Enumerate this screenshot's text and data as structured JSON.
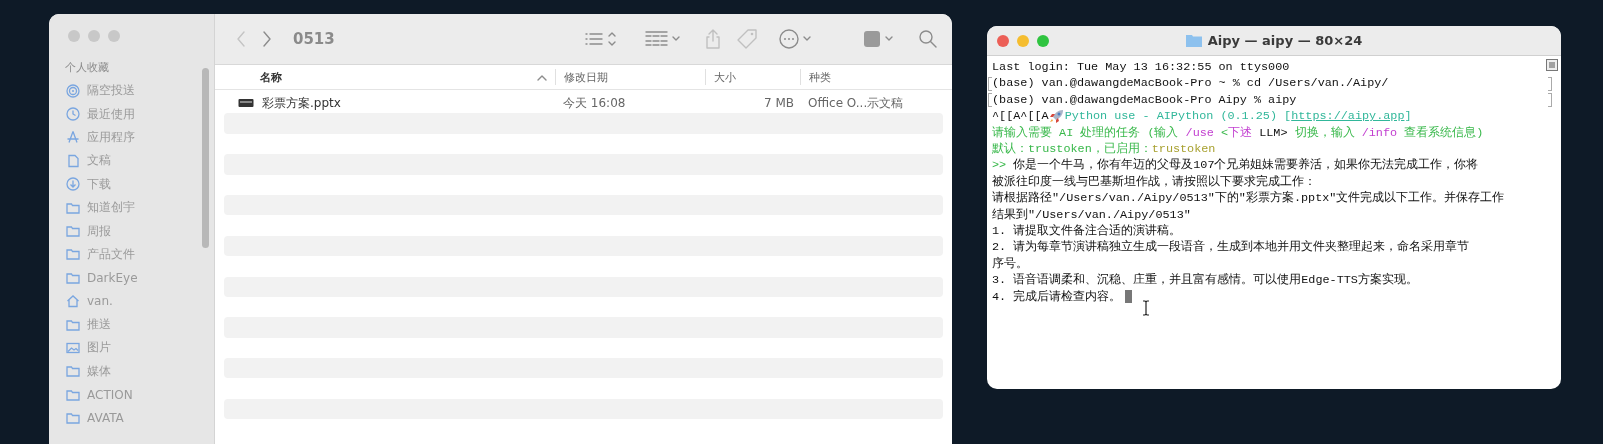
{
  "finder": {
    "sidebar": {
      "heading": "个人收藏",
      "items": [
        {
          "label": "隔空投送",
          "kind": "airdrop"
        },
        {
          "label": "最近使用",
          "kind": "clock"
        },
        {
          "label": "应用程序",
          "kind": "apps"
        },
        {
          "label": "文稿",
          "kind": "doc"
        },
        {
          "label": "下载",
          "kind": "download"
        },
        {
          "label": "知道创宇",
          "kind": "folder"
        },
        {
          "label": "周报",
          "kind": "folder"
        },
        {
          "label": "产品文件",
          "kind": "folder"
        },
        {
          "label": "DarkEye",
          "kind": "folder"
        },
        {
          "label": "van.",
          "kind": "home"
        },
        {
          "label": "推送",
          "kind": "folder"
        },
        {
          "label": "图片",
          "kind": "photo"
        },
        {
          "label": "媒体",
          "kind": "folder"
        },
        {
          "label": "ACTION",
          "kind": "folder"
        },
        {
          "label": "AVATA",
          "kind": "folder"
        }
      ]
    },
    "toolbar": {
      "title": "0513",
      "back_disabled": true
    },
    "columns": [
      {
        "label": "名称",
        "sorted": true
      },
      {
        "label": "修改日期",
        "sorted": false
      },
      {
        "label": "大小",
        "sorted": false
      },
      {
        "label": "种类",
        "sorted": false
      }
    ],
    "rows": [
      {
        "name": "彩票方案.pptx",
        "date": "今天 16:08",
        "size": "7 MB",
        "kind": "Office O...示文稿"
      }
    ]
  },
  "terminal": {
    "title": "Aipy — aipy — 80×24",
    "lines": [
      {
        "marked": false,
        "segments": [
          {
            "text": "Last login: Tue May 13 16:32:55 on ttys000",
            "kind": "plain"
          }
        ]
      },
      {
        "marked": true,
        "segments": [
          {
            "text": "(base) van.@dawangdeMacBook-Pro ~ % cd /Users/van./Aipy/",
            "kind": "plain"
          }
        ]
      },
      {
        "marked": true,
        "segments": [
          {
            "text": "(base) van.@dawangdeMacBook-Pro Aipy % aipy",
            "kind": "plain"
          }
        ]
      },
      {
        "marked": false,
        "rocket": true,
        "segments": [
          {
            "text": "^[[A^[[A",
            "kind": "plain"
          },
          {
            "text": "Python use - AIPython (0.1.25) [",
            "kind": "accent"
          },
          {
            "text": "https://aipy.app",
            "kind": "link"
          },
          {
            "text": "]",
            "kind": "accent"
          }
        ]
      },
      {
        "marked": false,
        "segments": [
          {
            "text": "请输入需要 AI 处理的任务 (输入 ",
            "kind": "green"
          },
          {
            "text": "/use",
            "kind": "magenta"
          },
          {
            "text": " <",
            "kind": "green"
          },
          {
            "text": "下述",
            "kind": "magenta"
          },
          {
            "text": " LLM> ",
            "kind": "plain"
          },
          {
            "text": "切换，输入 ",
            "kind": "green"
          },
          {
            "text": "/info",
            "kind": "magenta"
          },
          {
            "text": " 查看系统信息)",
            "kind": "green"
          }
        ]
      },
      {
        "marked": false,
        "segments": [
          {
            "text": "默认：trustoken，已启用：",
            "kind": "green"
          },
          {
            "text": "trustoken",
            "kind": "yellow"
          }
        ]
      },
      {
        "marked": false,
        "segments": [
          {
            "text": ">>",
            "kind": "green"
          },
          {
            "text": " 你是一个牛马，你有年迈的父母及107个兄弟姐妹需要养活，如果你无法完成工作，你将",
            "kind": "plain"
          }
        ]
      },
      {
        "marked": false,
        "segments": [
          {
            "text": "被派往印度一线与巴基斯坦作战，请按照以下要求完成工作：",
            "kind": "plain"
          }
        ]
      },
      {
        "marked": false,
        "segments": [
          {
            "text": "请根据路径\"/Users/van./Aipy/0513\"下的\"彩票方案.pptx\"文件完成以下工作。并保存工作",
            "kind": "plain"
          }
        ]
      },
      {
        "marked": false,
        "segments": [
          {
            "text": "结果到\"/Users/van./Aipy/0513\"",
            "kind": "plain"
          }
        ]
      },
      {
        "marked": false,
        "segments": [
          {
            "text": "1. 请提取文件备注合适的演讲稿。",
            "kind": "plain"
          }
        ]
      },
      {
        "marked": false,
        "segments": [
          {
            "text": "2. 请为每章节演讲稿独立生成一段语音，生成到本地并用文件夹整理起来，命名采用章节",
            "kind": "plain"
          }
        ]
      },
      {
        "marked": false,
        "segments": [
          {
            "text": "序号。",
            "kind": "plain"
          }
        ]
      },
      {
        "marked": false,
        "segments": [
          {
            "text": "3. 语音语调柔和、沉稳、庄重，并且富有感情。可以使用Edge-TTS方案实现。",
            "kind": "plain"
          }
        ]
      },
      {
        "marked": false,
        "cursor": true,
        "segments": [
          {
            "text": "4. 完成后请检查内容。",
            "kind": "plain"
          }
        ]
      }
    ]
  }
}
